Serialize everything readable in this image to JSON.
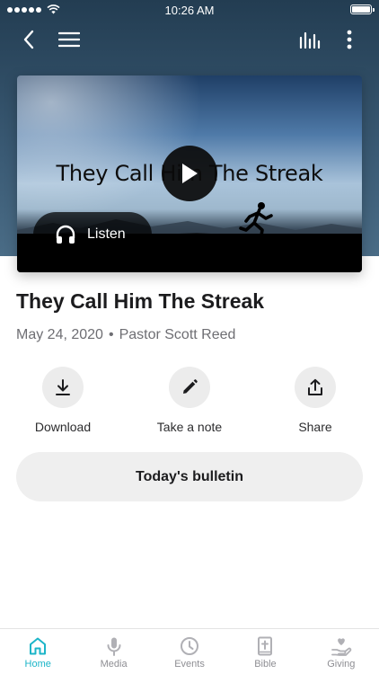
{
  "status_bar": {
    "time": "10:26 AM"
  },
  "nav": {
    "back_icon": "chevron-left-icon",
    "menu_icon": "hamburger-icon",
    "audio_icon": "audio-bars-icon",
    "more_icon": "more-vertical-icon"
  },
  "media": {
    "thumbnail_title": "They Call Him The Streak",
    "listen_label": "Listen",
    "play_icon": "play-icon"
  },
  "sermon": {
    "title": "They Call Him The Streak",
    "date": "May 24, 2020",
    "separator": "•",
    "speaker": "Pastor Scott Reed"
  },
  "actions": [
    {
      "label": "Download",
      "icon": "download-icon"
    },
    {
      "label": "Take a note",
      "icon": "pencil-icon"
    },
    {
      "label": "Share",
      "icon": "share-icon"
    }
  ],
  "bulletin": {
    "label": "Today's bulletin"
  },
  "tabs": [
    {
      "label": "Home",
      "icon": "home-icon",
      "active": true
    },
    {
      "label": "Media",
      "icon": "microphone-icon",
      "active": false
    },
    {
      "label": "Events",
      "icon": "clock-icon",
      "active": false
    },
    {
      "label": "Bible",
      "icon": "bible-icon",
      "active": false
    },
    {
      "label": "Giving",
      "icon": "giving-icon",
      "active": false
    }
  ],
  "colors": {
    "accent": "#1cb5c8",
    "header": "#2f4d66"
  }
}
